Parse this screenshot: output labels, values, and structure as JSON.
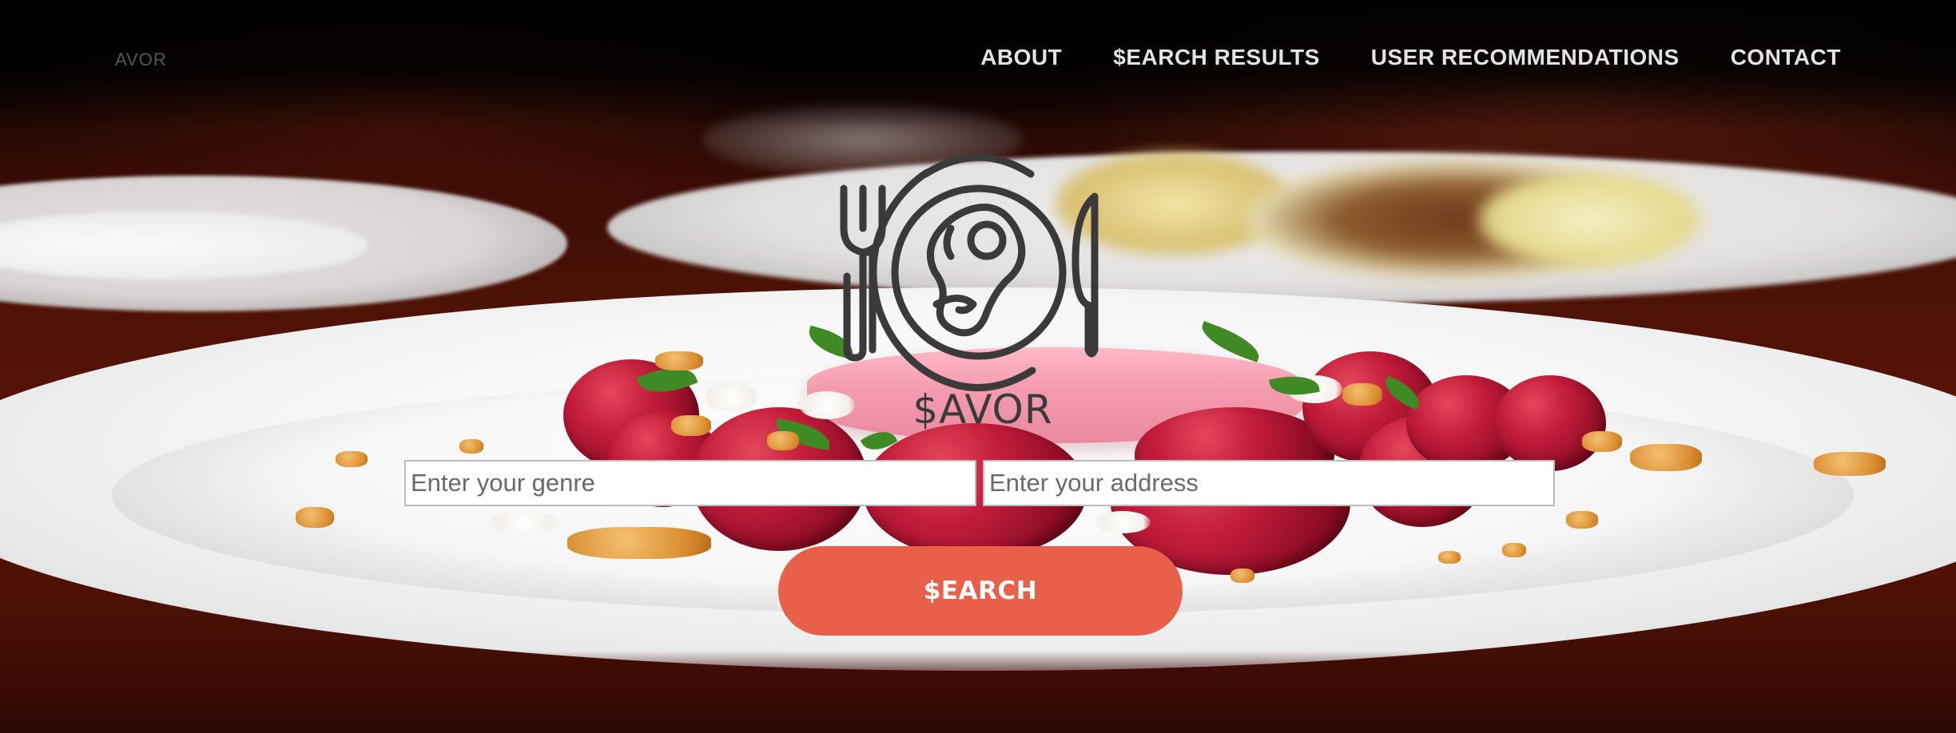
{
  "brand": {
    "name": "AVOR"
  },
  "nav": {
    "items": [
      {
        "label": "ABOUT"
      },
      {
        "label": "$EARCH RESULTS"
      },
      {
        "label": "USER RECOMMENDATIONS"
      },
      {
        "label": "CONTACT"
      }
    ]
  },
  "logo": {
    "icon": "plate-fork-knife-icon",
    "text": "$AVOR",
    "color": "#3a3a3a"
  },
  "search": {
    "genre_placeholder": "Enter your genre",
    "genre_value": "",
    "address_placeholder": "Enter your address",
    "address_value": "",
    "button_label": "$EARCH",
    "button_color": "#e8604a"
  },
  "colors": {
    "nav_text": "#e3e3e3",
    "accent": "#e8604a"
  }
}
